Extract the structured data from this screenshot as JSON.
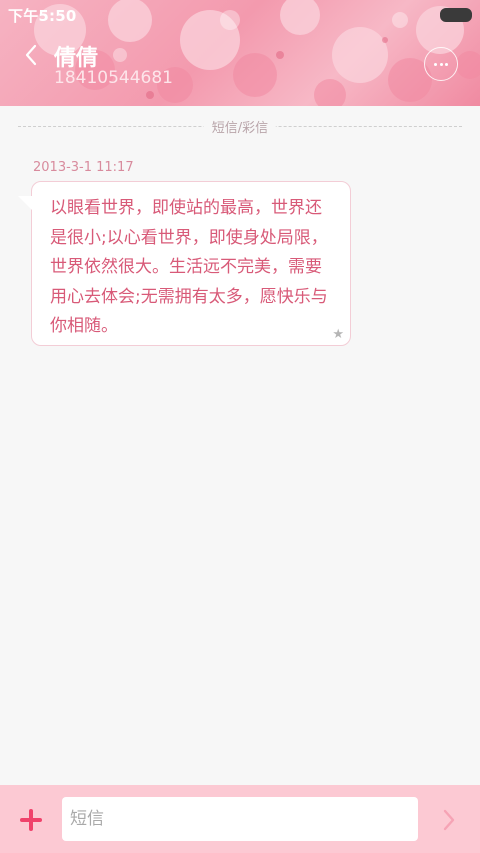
{
  "status_bar": {
    "time": "下午5:50"
  },
  "header": {
    "contact_name": "倩倩",
    "contact_number": "18410544681"
  },
  "thread": {
    "divider_label": "短信/彩信",
    "messages": [
      {
        "timestamp": "2013-3-1 11:17",
        "text": "以眼看世界，即使站的最高，世界还是很小;以心看世界，即使身处局限，世界依然很大。生活远不完美，需要用心去体会;无需拥有太多，愿快乐与你相随。",
        "starred": true,
        "star_glyph": "★"
      }
    ]
  },
  "composer": {
    "placeholder": "短信",
    "value": ""
  },
  "icons": {
    "back": "chevron-left-icon",
    "more": "more-icon",
    "star": "star-icon",
    "add": "plus-icon",
    "send": "chevron-right-icon"
  },
  "colors": {
    "accent": "#f0426b",
    "bubble_text": "#d85a78",
    "timestamp": "#d88b9d",
    "bottom_bar": "#fcc9d3"
  }
}
